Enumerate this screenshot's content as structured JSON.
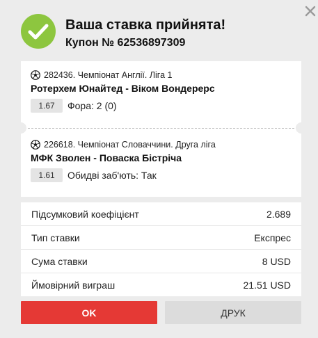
{
  "header": {
    "title": "Ваша ставка прийнята!",
    "coupon": "Купон № 62536897309"
  },
  "icons": {
    "success": "check-circle-icon",
    "close": "close-icon",
    "sport": "soccer-ball-icon"
  },
  "colors": {
    "success": "#8dc63f",
    "primary": "#e53935",
    "secondary": "#dcdcdc",
    "background": "#ececec"
  },
  "bets": [
    {
      "league": "282436. Чемпіонат Англії. Ліга 1",
      "match": "Ротерхем Юнайтед - Віком Вондерерс",
      "odd": "1.67",
      "outcome": "Фора: 2 (0)"
    },
    {
      "league": "226618. Чемпіонат Словаччини. Друга ліга",
      "match": "МФК Зволен - Поваска Бістріча",
      "odd": "1.61",
      "outcome": "Обидві заб'ють: Так"
    }
  ],
  "summary": [
    {
      "label": "Підсумковий коефіцієнт",
      "value": "2.689"
    },
    {
      "label": "Тип ставки",
      "value": "Експрес"
    },
    {
      "label": "Сума ставки",
      "value": "8 USD"
    },
    {
      "label": "Ймовірний виграш",
      "value": "21.51 USD"
    }
  ],
  "buttons": {
    "ok": "OK",
    "print": "ДРУК"
  }
}
